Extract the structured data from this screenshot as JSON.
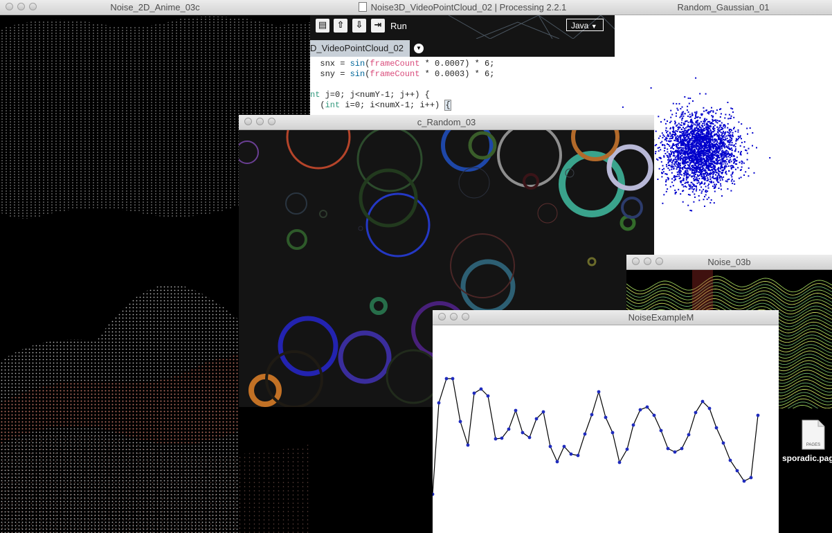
{
  "windows": {
    "noise2d": {
      "title": "Noise_2D_Anime_03c"
    },
    "editor": {
      "title": "Noise3D_VideoPointCloud_02 | Processing 2.2.1",
      "run_label": "Run",
      "mode": "Java",
      "tab_label": "D_VideoPointCloud_02",
      "code_lines": [
        "snx = sin(frameCount * 0.0007) * 6;",
        "sny = sin(frameCount * 0.0003) * 6;",
        "",
        "nt j=0; j<numY-1; j++) {",
        "(int i=0; i<numX-1; i++) {"
      ]
    },
    "gaussian": {
      "title": "Random_Gaussian_01"
    },
    "random": {
      "title": "c_Random_03"
    },
    "noise03b": {
      "title": "Noise_03b"
    },
    "noiseexample": {
      "title": "NoiseExampleM"
    }
  },
  "desktop": {
    "file_label": "sporadic.pages",
    "file_icon_text": "PAGES"
  },
  "colors": {
    "gaussian_dots": "#0000cc",
    "line_chart_points": "#1f2bbd"
  }
}
